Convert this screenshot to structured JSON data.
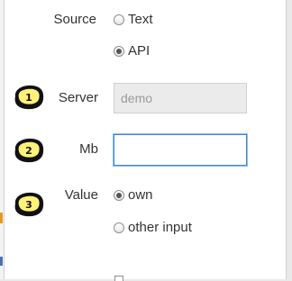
{
  "form": {
    "source": {
      "label": "Source",
      "options": [
        {
          "label": "Text",
          "selected": false
        },
        {
          "label": "API",
          "selected": true
        }
      ]
    },
    "server": {
      "step": "1",
      "label": "Server",
      "value": "demo",
      "disabled": true
    },
    "mb": {
      "step": "2",
      "label": "Mb",
      "value": "",
      "focused": true
    },
    "value": {
      "step": "3",
      "label": "Value",
      "options": [
        {
          "label": "own",
          "selected": true
        },
        {
          "label": "other input",
          "selected": false
        }
      ]
    }
  },
  "colors": {
    "marker_fill": "#fff27a",
    "marker_outline": "#111111",
    "focus_border": "#3b88d8"
  },
  "icons": {
    "step_marker": "numbered-badge-icon"
  }
}
